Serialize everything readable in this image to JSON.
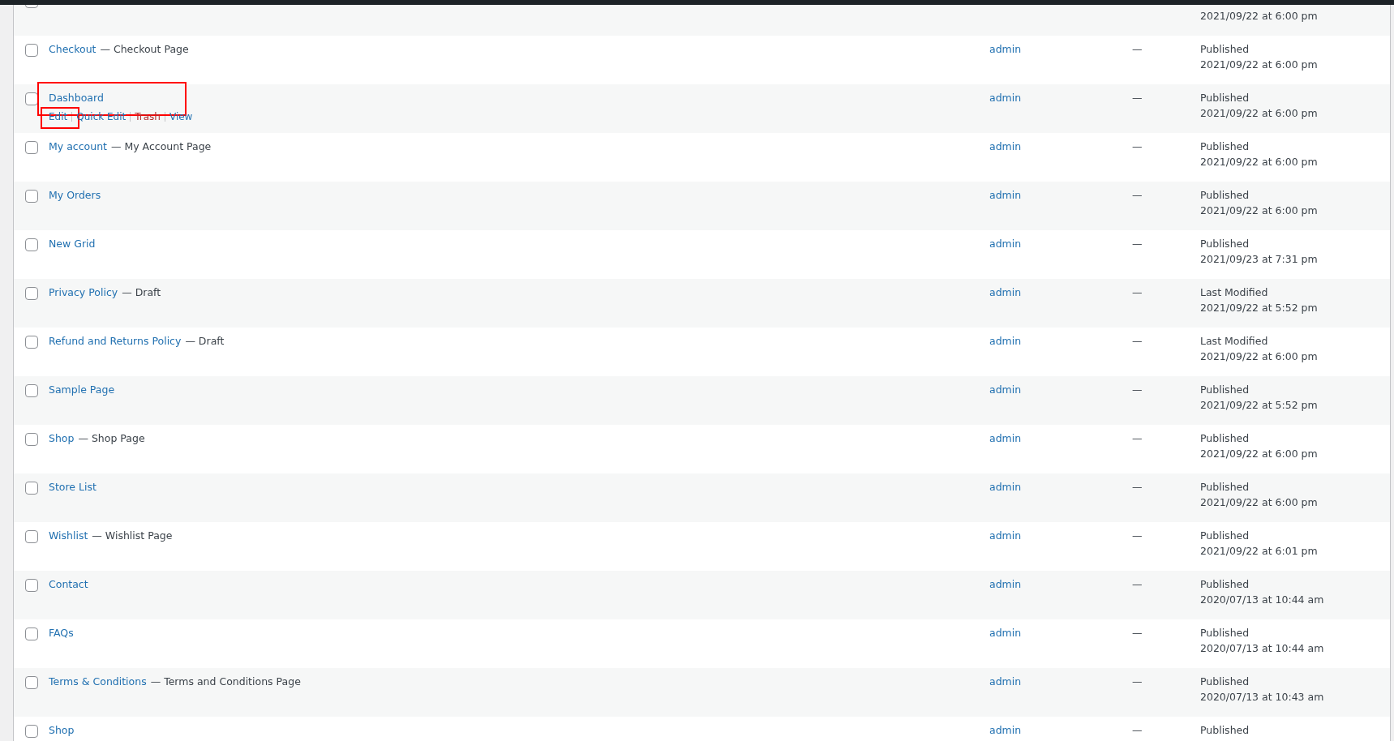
{
  "rows": [
    {
      "date": "2021/09/22 at 6:00 pm",
      "checked": false
    },
    {
      "title": "Checkout",
      "state": "— Checkout Page",
      "author": "admin",
      "comments": "—",
      "date_label": "Published",
      "date": "2021/09/22 at 6:00 pm",
      "checked": false
    },
    {
      "title": "Dashboard",
      "author": "admin",
      "comments": "—",
      "date_label": "Published",
      "date": "2021/09/22 at 6:00 pm",
      "checked": false,
      "highlighted": true,
      "actions": [
        {
          "label": "Edit",
          "kind": "link",
          "highlighted": true
        },
        {
          "label": "Quick Edit",
          "kind": "link"
        },
        {
          "label": "Trash",
          "kind": "delete"
        },
        {
          "label": "View",
          "kind": "link"
        }
      ]
    },
    {
      "title": "My account",
      "state": "— My Account Page",
      "author": "admin",
      "comments": "—",
      "date_label": "Published",
      "date": "2021/09/22 at 6:00 pm",
      "checked": false
    },
    {
      "title": "My Orders",
      "author": "admin",
      "comments": "—",
      "date_label": "Published",
      "date": "2021/09/22 at 6:00 pm",
      "checked": false
    },
    {
      "title": "New Grid",
      "author": "admin",
      "comments": "—",
      "date_label": "Published",
      "date": "2021/09/23 at 7:31 pm",
      "checked": false
    },
    {
      "title": "Privacy Policy",
      "state": "— Draft",
      "author": "admin",
      "comments": "—",
      "date_label": "Last Modified",
      "date": "2021/09/22 at 5:52 pm",
      "checked": false
    },
    {
      "title": "Refund and Returns Policy",
      "state": "— Draft",
      "author": "admin",
      "comments": "—",
      "date_label": "Last Modified",
      "date": "2021/09/22 at 6:00 pm",
      "checked": false
    },
    {
      "title": "Sample Page",
      "author": "admin",
      "comments": "—",
      "date_label": "Published",
      "date": "2021/09/22 at 5:52 pm",
      "checked": false
    },
    {
      "title": "Shop",
      "state": "— Shop Page",
      "author": "admin",
      "comments": "—",
      "date_label": "Published",
      "date": "2021/09/22 at 6:00 pm",
      "checked": false
    },
    {
      "title": "Store List",
      "author": "admin",
      "comments": "—",
      "date_label": "Published",
      "date": "2021/09/22 at 6:00 pm",
      "checked": false
    },
    {
      "title": "Wishlist",
      "state": "— Wishlist Page",
      "author": "admin",
      "comments": "—",
      "date_label": "Published",
      "date": "2021/09/22 at 6:01 pm",
      "checked": false
    },
    {
      "title": "Contact",
      "author": "admin",
      "comments": "—",
      "date_label": "Published",
      "date": "2020/07/13 at 10:44 am",
      "checked": false
    },
    {
      "title": "FAQs",
      "author": "admin",
      "comments": "—",
      "date_label": "Published",
      "date": "2020/07/13 at 10:44 am",
      "checked": false
    },
    {
      "title": "Terms & Conditions",
      "state": "— Terms and Conditions Page",
      "author": "admin",
      "comments": "—",
      "date_label": "Published",
      "date": "2020/07/13 at 10:43 am",
      "checked": false
    },
    {
      "title": "Shop",
      "author": "admin",
      "comments": "—",
      "date_label": "Published",
      "checked": false
    }
  ]
}
